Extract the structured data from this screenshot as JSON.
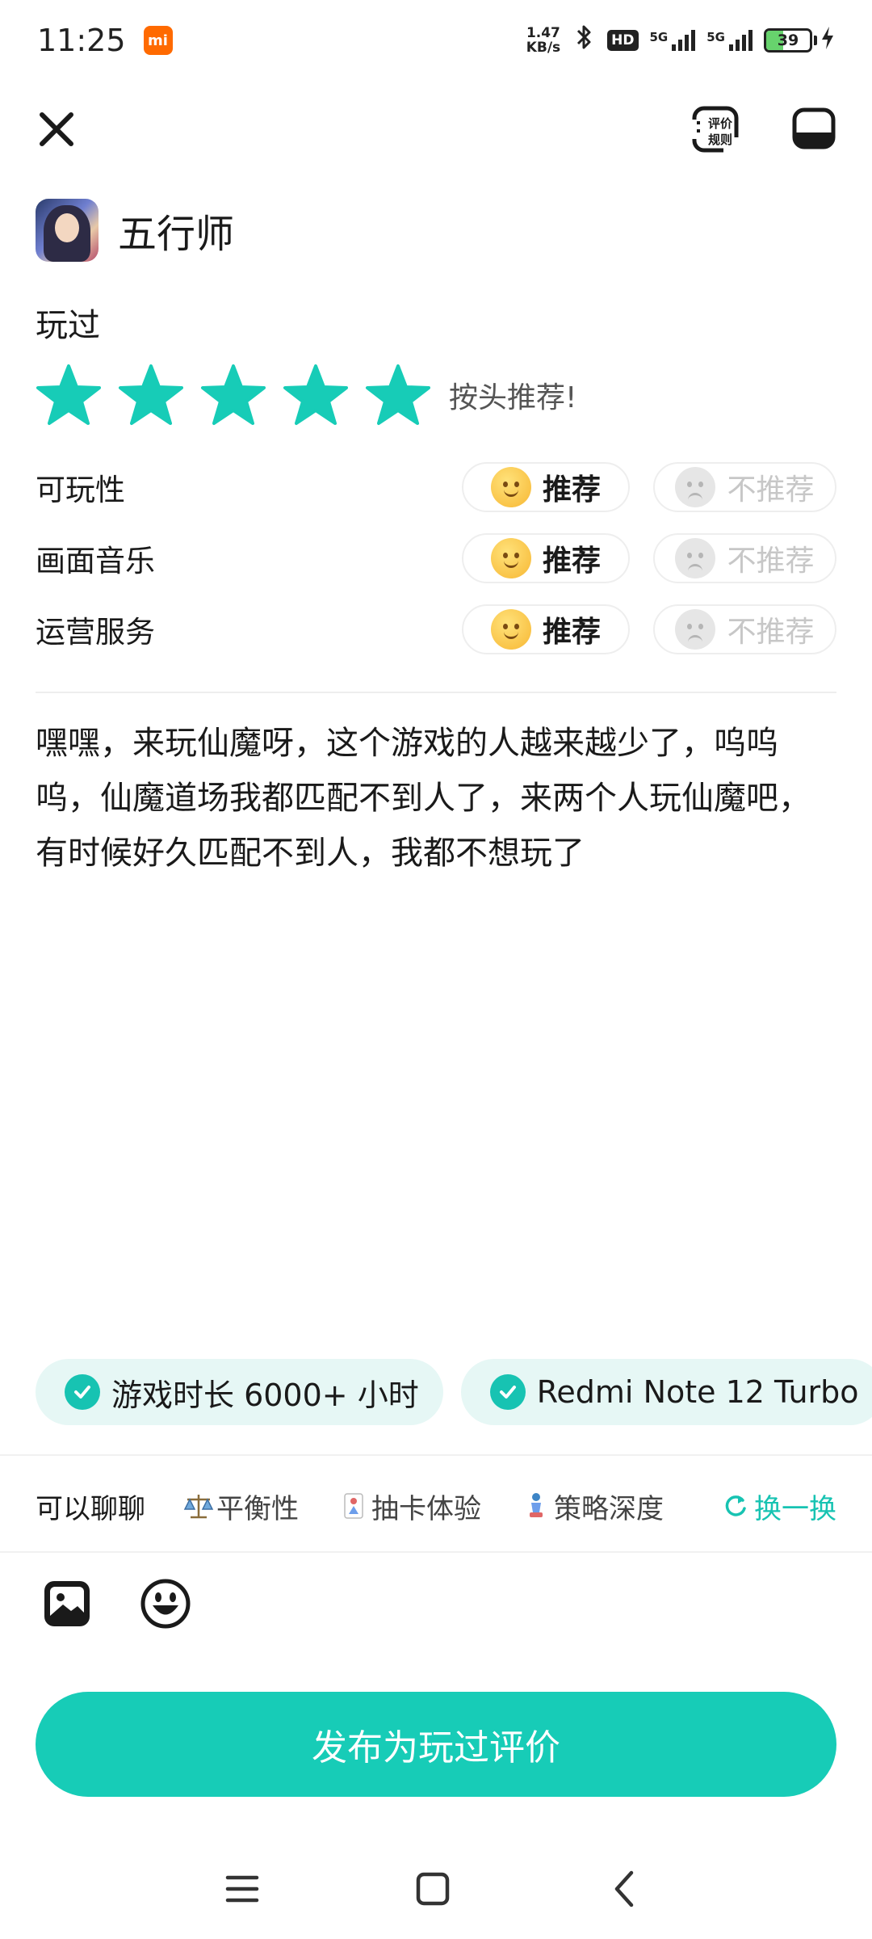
{
  "status_bar": {
    "time": "11:25",
    "mi_label": "mi",
    "net_speed_value": "1.47",
    "net_speed_unit": "KB/s",
    "hd_label": "HD",
    "signal1_label": "5G",
    "signal2_label": "5G",
    "battery_percent": "39",
    "battery_level": 0.39
  },
  "top_bar": {
    "rules_label_line1": "评价",
    "rules_label_line2": "规则"
  },
  "game": {
    "title": "五行师"
  },
  "review": {
    "status_label": "玩过",
    "rating": 5,
    "rating_max": 5,
    "rating_text": "按头推荐!",
    "accent_color": "#17ccb7",
    "aspects": [
      {
        "label": "可玩性",
        "recommend_label": "推荐",
        "not_recommend_label": "不推荐",
        "selected": "recommend"
      },
      {
        "label": "画面音乐",
        "recommend_label": "推荐",
        "not_recommend_label": "不推荐",
        "selected": "recommend"
      },
      {
        "label": "运营服务",
        "recommend_label": "推荐",
        "not_recommend_label": "不推荐",
        "selected": "recommend"
      }
    ],
    "text": "嘿嘿，来玩仙魔呀，这个游戏的人越来越少了，呜呜呜，仙魔道场我都匹配不到人了，来两个人玩仙魔吧，有时候好久匹配不到人，我都不想玩了"
  },
  "tags": [
    {
      "label": "游戏时长 6000+ 小时"
    },
    {
      "label": "Redmi Note 12 Turbo"
    }
  ],
  "chat_topics": {
    "lead": "可以聊聊",
    "topics": [
      {
        "label": "平衡性",
        "icon": "scale-icon"
      },
      {
        "label": "抽卡体验",
        "icon": "card-icon"
      },
      {
        "label": "策略深度",
        "icon": "chess-icon"
      }
    ],
    "refresh_label": "换一换"
  },
  "publish_button": "发布为玩过评价"
}
